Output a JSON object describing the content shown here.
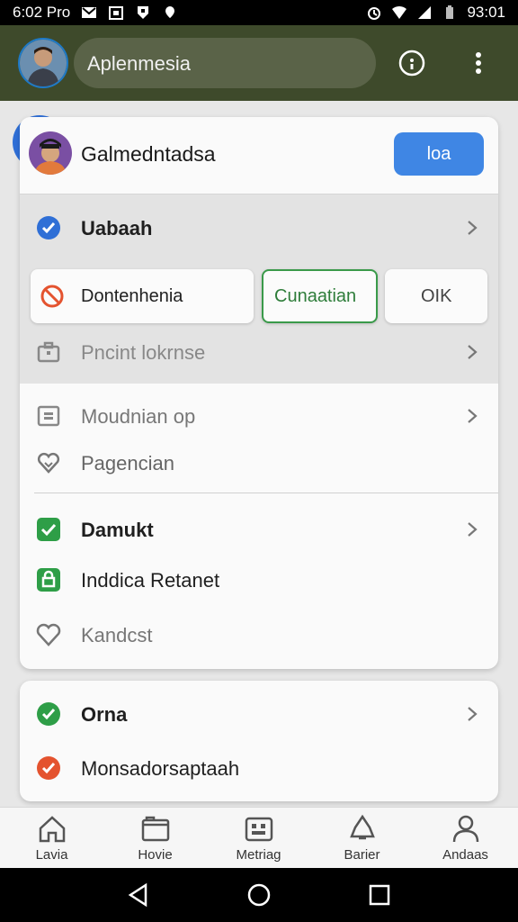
{
  "status_bar": {
    "time_left": "6:02 Pro",
    "time_right": "93:01"
  },
  "app_bar": {
    "search_text": "Aplenmesia"
  },
  "card_main": {
    "title": "Galmedntadsa",
    "action_button": "loa",
    "rows": [
      {
        "label": "Uabaah",
        "icon": "check-circle-icon",
        "color": "#2f6fd6"
      },
      {
        "label": "Pncint lokrnse",
        "icon": "briefcase-icon",
        "color": "#888888"
      },
      {
        "label": "Moudnian op",
        "icon": "calendar-icon",
        "color": "#888888"
      },
      {
        "label": "Pagencian",
        "icon": "heart-icon",
        "color": "#888888"
      },
      {
        "label": "Damukt",
        "icon": "check-square-icon",
        "color": "#2e9e47"
      },
      {
        "label": "Inddica Retanet",
        "icon": "lock-icon",
        "color": "#2e9e47"
      },
      {
        "label": "Kandcst",
        "icon": "heart-outline-icon",
        "color": "#888888"
      }
    ],
    "segments": {
      "first": "Dontenhenia",
      "second": "Cunaatian",
      "third": "OIK"
    }
  },
  "card_secondary": {
    "rows": [
      {
        "label": "Orna",
        "icon": "check-square-icon",
        "color": "#2e9e47"
      },
      {
        "label": "Monsadorsaptaah",
        "icon": "check-circle-icon",
        "color": "#e4532f"
      }
    ]
  },
  "bottom_nav": [
    {
      "label": "Lavia",
      "icon": "home-icon"
    },
    {
      "label": "Hovie",
      "icon": "folder-icon"
    },
    {
      "label": "Metriag",
      "icon": "grid-icon"
    },
    {
      "label": "Barier",
      "icon": "bell-icon"
    },
    {
      "label": "Andaas",
      "icon": "person-icon"
    }
  ],
  "colors": {
    "app_bar": "#3e4a2b",
    "accent_blue": "#3f86e4",
    "success_green": "#2e9e47",
    "danger_red": "#e4532f"
  }
}
